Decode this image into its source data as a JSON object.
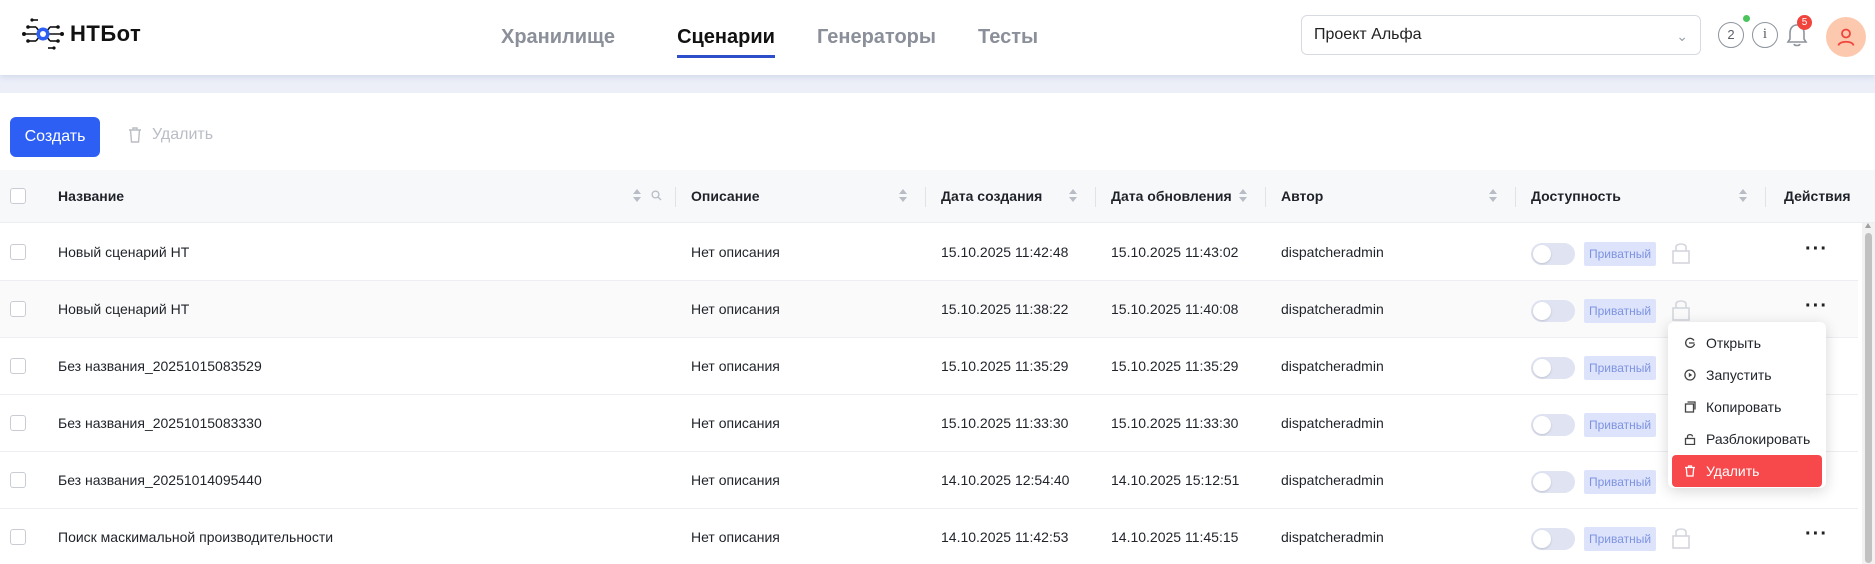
{
  "app": {
    "logo_text": "НТБот"
  },
  "nav": {
    "items": [
      "Хранилище",
      "Сценарии",
      "Генераторы",
      "Тесты"
    ],
    "active": "Сценарии"
  },
  "header": {
    "project": "Проект Альфа",
    "counter": "2",
    "info": "i",
    "notifications": "5"
  },
  "toolbar": {
    "create_label": "Создать",
    "delete_label": "Удалить"
  },
  "table": {
    "columns": [
      "Название",
      "Описание",
      "Дата создания",
      "Дата обновления",
      "Автор",
      "Доступность",
      "Действия"
    ],
    "rows": [
      {
        "name": "Новый сценарий НТ",
        "description": "Нет описания",
        "created": "15.10.2025 11:42:48",
        "updated": "15.10.2025 11:43:02",
        "author": "dispatcheradmin",
        "access": "Приватный"
      },
      {
        "name": "Новый сценарий НТ",
        "description": "Нет описания",
        "created": "15.10.2025 11:38:22",
        "updated": "15.10.2025 11:40:08",
        "author": "dispatcheradmin",
        "access": "Приватный"
      },
      {
        "name": "Без названия_20251015083529",
        "description": "Нет описания",
        "created": "15.10.2025 11:35:29",
        "updated": "15.10.2025 11:35:29",
        "author": "dispatcheradmin",
        "access": "Приватный"
      },
      {
        "name": "Без названия_20251015083330",
        "description": "Нет описания",
        "created": "15.10.2025 11:33:30",
        "updated": "15.10.2025 11:33:30",
        "author": "dispatcheradmin",
        "access": "Приватный"
      },
      {
        "name": "Без названия_20251014095440",
        "description": "Нет описания",
        "created": "14.10.2025 12:54:40",
        "updated": "14.10.2025 15:12:51",
        "author": "dispatcheradmin",
        "access": "Приватный"
      },
      {
        "name": "Поиск маскимальной производительности",
        "description": "Нет описания",
        "created": "14.10.2025 11:42:53",
        "updated": "14.10.2025 11:45:15",
        "author": "dispatcheradmin",
        "access": "Приватный"
      }
    ]
  },
  "context_menu": {
    "items": [
      "Открыть",
      "Запустить",
      "Копировать",
      "Разблокировать",
      "Удалить"
    ]
  },
  "colors": {
    "primary": "#2d5ff5",
    "nav_underline": "#2c4ecb",
    "danger": "#f7494c",
    "tag_bg": "#dde3fb",
    "tag_text": "#7d93e0"
  }
}
